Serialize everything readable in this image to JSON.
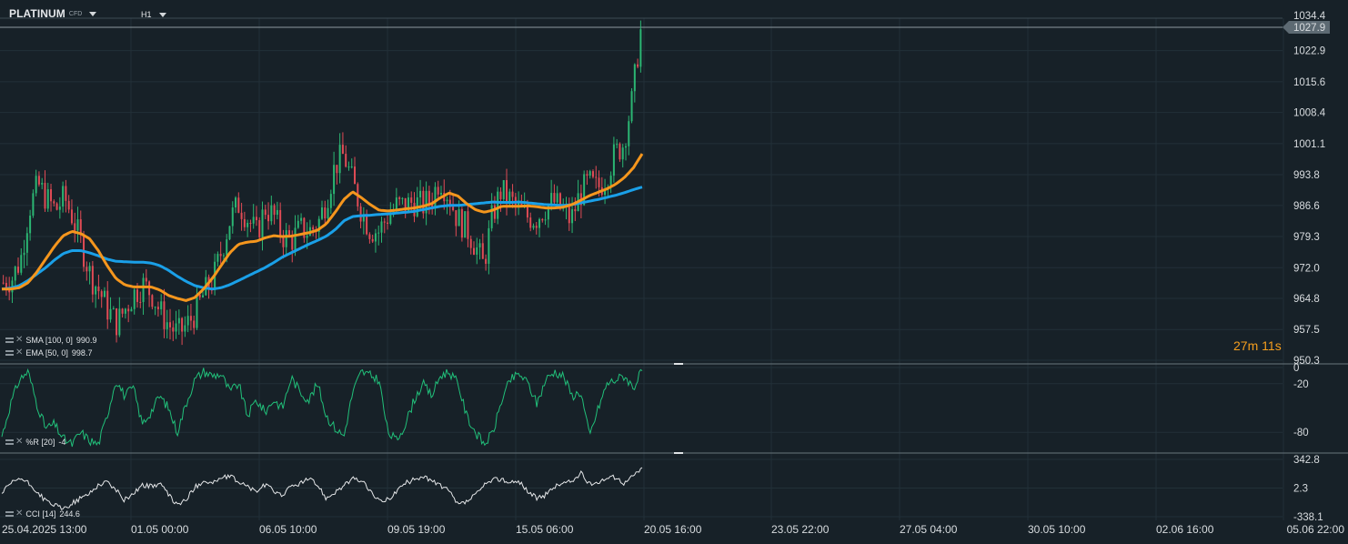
{
  "header": {
    "symbol": "PLATINUM",
    "instrument_type": "CFD",
    "timeframe": "H1"
  },
  "countdown": {
    "minutes": "27",
    "m_unit": "m",
    "seconds": "11",
    "s_unit": "s"
  },
  "colors": {
    "background": "#172128",
    "grid": "#223038",
    "bull": "#2bb673",
    "bear": "#e04b55",
    "sma": "#1aa0e8",
    "ema": "#f5961d",
    "wr": "#21c07a",
    "cci": "#e6e8ea",
    "current_price_bg": "#5d6a73"
  },
  "indicators": {
    "sma": {
      "label": "SMA [100,  0]",
      "value": "990.9"
    },
    "ema": {
      "label": "EMA [50,  0]",
      "value": "998.7"
    },
    "wr": {
      "label": "%R [20]",
      "value": "-4"
    },
    "cci": {
      "label": "CCI [14]",
      "value": "244.6"
    }
  },
  "chart_data": {
    "type": "candlestick",
    "title": "PLATINUM CFD",
    "timeframe": "H1",
    "price_axis": {
      "ticks": [
        1022.9,
        1015.6,
        1008.4,
        1001.1,
        993.8,
        986.6,
        979.3,
        972.0,
        964.8,
        957.5,
        950.3
      ],
      "current_price": 1027.9,
      "partial_top_label": "1034.4",
      "range": [
        950.3,
        1030.5
      ]
    },
    "time_axis": {
      "ticks": [
        "25.04.2025  13:00",
        "01.05  00:00",
        "06.05  10:00",
        "09.05  19:00",
        "15.05  06:00",
        "20.05  16:00",
        "23.05  22:00",
        "27.05  04:00",
        "30.05  10:00",
        "02.06  16:00",
        "05.06  22:00"
      ]
    },
    "close_series": {
      "description": "approximate hourly close, evenly spaced from 25.04.2025 13:00 to 20.05 16:00",
      "values": [
        968.5,
        969.5,
        974.0,
        986.0,
        991.5,
        988.0,
        985.5,
        988.5,
        983.5,
        977.0,
        970.0,
        966.5,
        962.0,
        959.0,
        962.5,
        966.0,
        968.0,
        966.0,
        961.5,
        958.5,
        956.5,
        958.5,
        961.5,
        966.0,
        969.0,
        976.0,
        983.5,
        987.0,
        983.5,
        980.0,
        986.0,
        984.0,
        979.5,
        978.5,
        981.0,
        980.5,
        982.0,
        988.0,
        996.0,
        998.5,
        992.0,
        985.5,
        981.0,
        980.5,
        984.0,
        986.5,
        986.5,
        987.5,
        986.5,
        988.0,
        993.0,
        989.0,
        983.5,
        981.5,
        977.5,
        972.5,
        984.0,
        990.0,
        988.0,
        985.5,
        984.0,
        983.5,
        986.0,
        987.5,
        985.5,
        983.0,
        989.0,
        992.0,
        990.5,
        993.0,
        998.5,
        1001.0,
        1011.0,
        1027.9
      ]
    },
    "sma": {
      "name": "SMA [100, 0]",
      "last": 990.9,
      "values": [
        967.0,
        967.2,
        967.8,
        969.0,
        970.5,
        972.0,
        973.8,
        975.3,
        976.0,
        976.0,
        975.5,
        974.8,
        974.0,
        973.5,
        973.4,
        973.3,
        973.3,
        973.1,
        972.5,
        971.4,
        970.0,
        968.8,
        967.8,
        967.3,
        967.0,
        967.3,
        968.0,
        969.0,
        970.0,
        971.0,
        972.0,
        973.2,
        974.5,
        975.5,
        976.5,
        977.5,
        978.4,
        979.4,
        980.9,
        983.0,
        984.0,
        984.2,
        984.3,
        984.5,
        984.6,
        984.8,
        985.0,
        985.2,
        985.6,
        986.0,
        986.4,
        986.6,
        986.6,
        986.8,
        987.0,
        987.2,
        987.4,
        987.3,
        987.3,
        987.4,
        987.2,
        987.0,
        986.8,
        986.7,
        986.6,
        986.8,
        987.2,
        987.6,
        988.0,
        988.5,
        989.0,
        989.6,
        990.3,
        990.9
      ]
    },
    "ema": {
      "name": "EMA [50, 0]",
      "last": 998.7,
      "values": [
        967.0,
        967.0,
        967.3,
        968.5,
        971.0,
        974.0,
        977.0,
        979.5,
        980.5,
        980.0,
        978.8,
        976.0,
        972.5,
        969.5,
        968.0,
        967.5,
        967.5,
        967.5,
        966.8,
        965.5,
        964.8,
        964.3,
        965.0,
        967.0,
        969.5,
        972.5,
        975.5,
        977.5,
        978.0,
        978.2,
        979.0,
        979.5,
        979.3,
        979.4,
        979.8,
        980.2,
        980.8,
        982.3,
        985.0,
        988.0,
        989.8,
        988.4,
        986.8,
        985.5,
        985.3,
        985.5,
        985.8,
        986.0,
        986.4,
        987.0,
        988.4,
        989.5,
        988.8,
        987.0,
        985.6,
        985.0,
        985.5,
        986.4,
        986.4,
        986.4,
        986.5,
        986.3,
        986.0,
        986.0,
        986.2,
        986.8,
        987.8,
        988.9,
        989.7,
        990.5,
        991.6,
        993.2,
        995.4,
        998.7
      ]
    },
    "williams_r": {
      "name": "%R [20]",
      "last": -4,
      "ticks": [
        0,
        -20,
        -80
      ],
      "range": [
        -100,
        0
      ],
      "values": [
        -85,
        -45,
        -15,
        -5,
        -45,
        -75,
        -70,
        -88,
        -95,
        -80,
        -90,
        -95,
        -60,
        -15,
        -35,
        -25,
        -70,
        -55,
        -35,
        -50,
        -80,
        -45,
        -15,
        -5,
        -10,
        -8,
        -30,
        -20,
        -60,
        -40,
        -55,
        -40,
        -50,
        -12,
        -30,
        -40,
        -20,
        -60,
        -75,
        -85,
        -30,
        -5,
        -10,
        -15,
        -80,
        -90,
        -70,
        -40,
        -20,
        -35,
        -10,
        -5,
        -20,
        -60,
        -80,
        -95,
        -80,
        -40,
        -15,
        -8,
        -20,
        -45,
        -15,
        -5,
        -10,
        -35,
        -30,
        -85,
        -50,
        -20,
        -15,
        -10,
        -25,
        -4
      ]
    },
    "cci": {
      "name": "CCI [14]",
      "last": 244.6,
      "ticks": [
        342.8,
        2.3,
        -338.1
      ],
      "range": [
        -338.1,
        342.8
      ],
      "values": [
        -60,
        50,
        120,
        60,
        -40,
        -150,
        -200,
        -250,
        -180,
        -120,
        -60,
        40,
        80,
        -20,
        -140,
        -60,
        40,
        20,
        60,
        -80,
        -200,
        -140,
        10,
        90,
        60,
        120,
        140,
        80,
        20,
        -40,
        40,
        -30,
        -80,
        20,
        60,
        110,
        40,
        -120,
        -40,
        30,
        110,
        90,
        -30,
        -160,
        -130,
        -40,
        60,
        100,
        150,
        80,
        40,
        -40,
        -200,
        -160,
        -80,
        30,
        100,
        110,
        60,
        80,
        -40,
        -120,
        -80,
        20,
        60,
        80,
        180,
        40,
        80,
        120,
        130,
        60,
        150,
        244.6
      ]
    }
  }
}
